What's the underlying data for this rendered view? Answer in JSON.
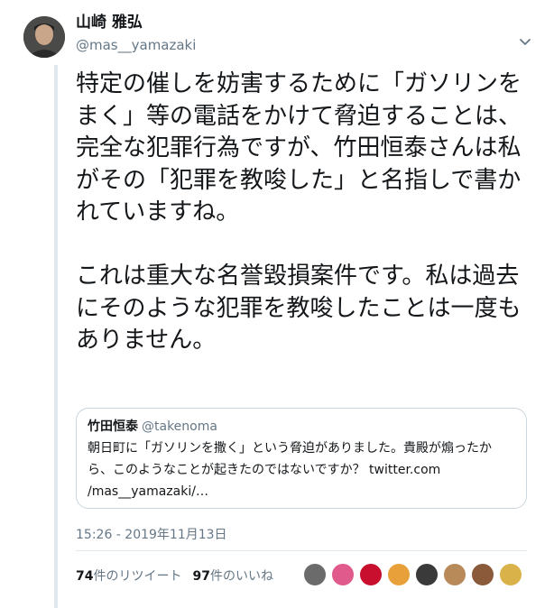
{
  "tweet": {
    "display_name": "山崎 雅弘",
    "handle": "@mas__yamazaki",
    "text": "特定の催しを妨害するために「ガソリンをまく」等の電話をかけて脅迫することは、完全な犯罪行為ですが、竹田恒泰さんは私がその「犯罪を教唆した」と名指しで書かれていますね。\n\nこれは重大な名誉毀損案件です。私は過去にそのような犯罪を教唆したことは一度もありません。",
    "timestamp": "15:26 - 2019年11月13日"
  },
  "quote": {
    "display_name": "竹田恒泰",
    "handle": "@takenoma",
    "text": "朝日町に「ガソリンを撒く」という脅迫がありました。貴殿が煽ったから、このようなことが起きたのではないですか？ twitter.com\n/mas__yamazaki/…"
  },
  "stats": {
    "retweets_count": "74",
    "retweets_label": "件のリツイート",
    "likes_count": "97",
    "likes_label": "件のいいね"
  },
  "icons": {
    "caret": "chevron-down-icon",
    "liker_colors": [
      "#6b6b6b",
      "#e05a8c",
      "#c8102e",
      "#e8a13a",
      "#3a3a3a",
      "#b88a5a",
      "#8a5a3a",
      "#d9b24a"
    ]
  }
}
